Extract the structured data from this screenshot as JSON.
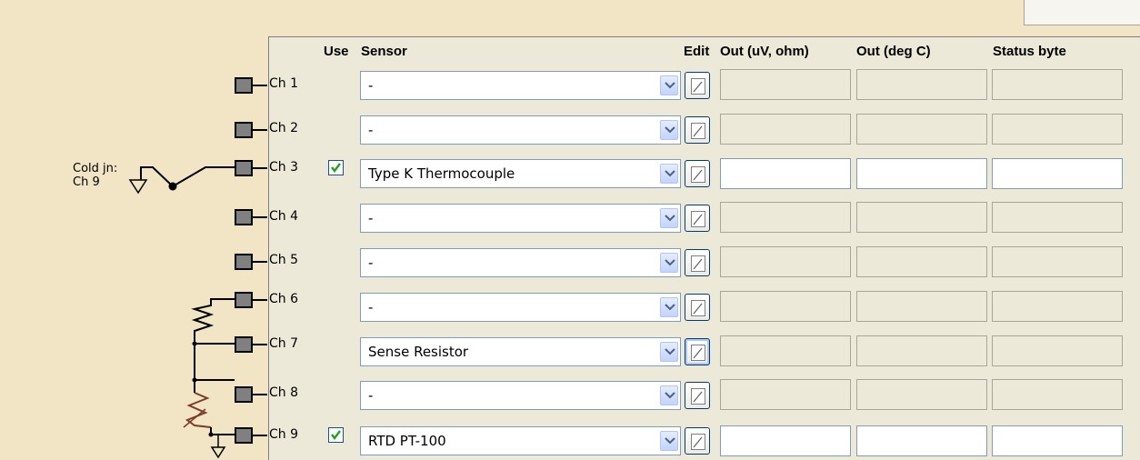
{
  "headers": {
    "use": "Use",
    "sensor": "Sensor",
    "edit": "Edit",
    "out_raw": "Out (uV, ohm)",
    "out_degc": "Out (deg C)",
    "status": "Status byte"
  },
  "cold_junction": {
    "line1": "Cold jn:",
    "line2": "Ch 9"
  },
  "rows": [
    {
      "channel": "Ch 1",
      "use": false,
      "sensor": "-",
      "out_raw": "",
      "out_degc": "",
      "status": ""
    },
    {
      "channel": "Ch 2",
      "use": false,
      "sensor": "-",
      "out_raw": "",
      "out_degc": "",
      "status": ""
    },
    {
      "channel": "Ch 3",
      "use": true,
      "sensor": "Type K Thermocouple",
      "out_raw": "",
      "out_degc": "",
      "status": ""
    },
    {
      "channel": "Ch 4",
      "use": false,
      "sensor": "-",
      "out_raw": "",
      "out_degc": "",
      "status": ""
    },
    {
      "channel": "Ch 5",
      "use": false,
      "sensor": "-",
      "out_raw": "",
      "out_degc": "",
      "status": ""
    },
    {
      "channel": "Ch 6",
      "use": false,
      "sensor": "-",
      "out_raw": "",
      "out_degc": "",
      "status": ""
    },
    {
      "channel": "Ch 7",
      "use": false,
      "sensor": "Sense Resistor",
      "out_raw": "",
      "out_degc": "",
      "status": ""
    },
    {
      "channel": "Ch 8",
      "use": false,
      "sensor": "-",
      "out_raw": "",
      "out_degc": "",
      "status": ""
    },
    {
      "channel": "Ch 9",
      "use": true,
      "sensor": "RTD PT-100",
      "out_raw": "",
      "out_degc": "",
      "status": ""
    }
  ],
  "icons": {
    "dropdown": "chevron-down-icon",
    "edit": "pencil-edit-icon",
    "check": "checkmark-icon",
    "pin": "terminal-pin-icon"
  },
  "colors": {
    "background": "#f1e5c6",
    "grid": "#ece9d8",
    "check": "#21a121"
  }
}
